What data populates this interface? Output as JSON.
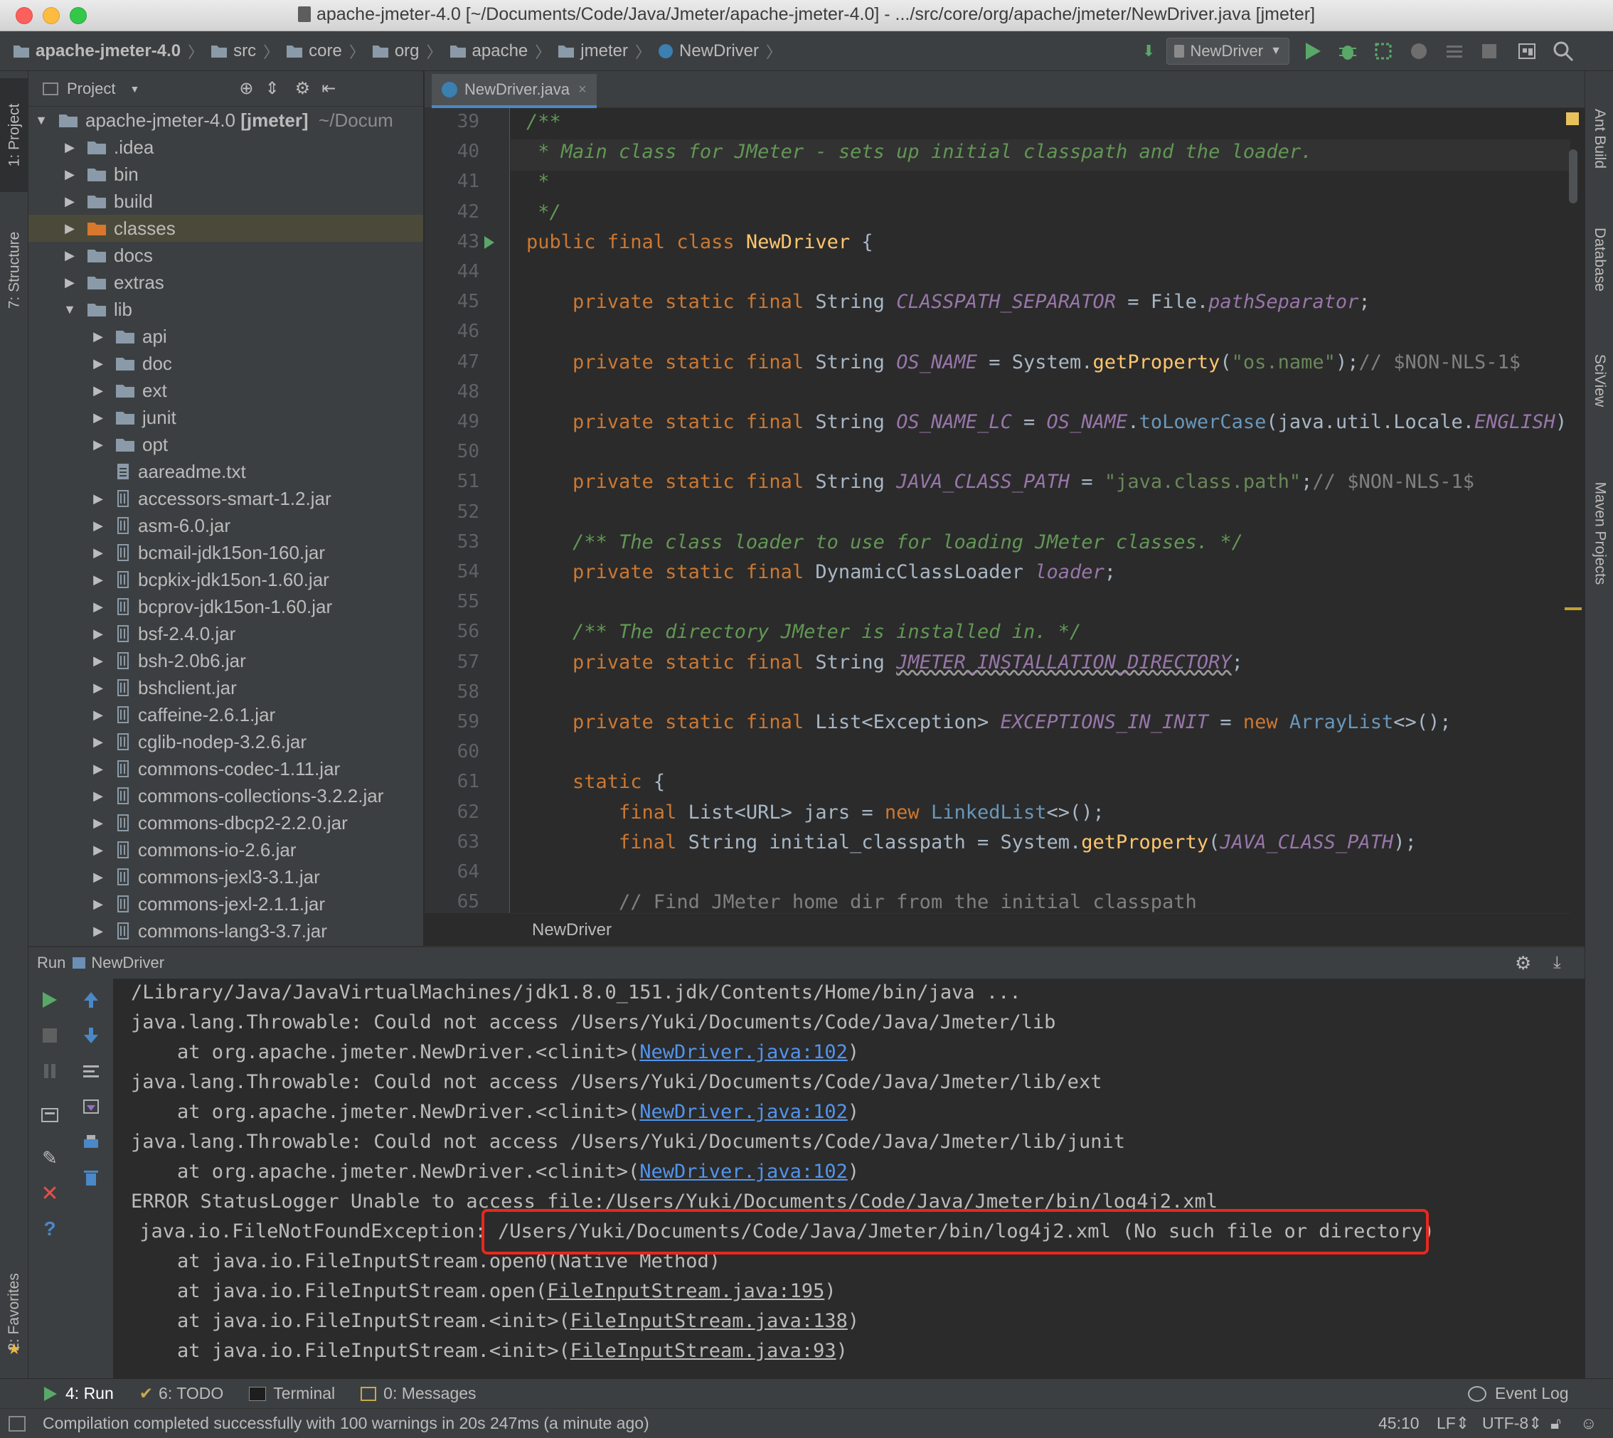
{
  "window": {
    "title": "apache-jmeter-4.0 [~/Documents/Code/Java/Jmeter/apache-jmeter-4.0] - .../src/core/org/apache/jmeter/NewDriver.java [jmeter]"
  },
  "navbar": {
    "crumbs": [
      "apache-jmeter-4.0",
      "src",
      "core",
      "org",
      "apache",
      "jmeter",
      "NewDriver"
    ],
    "run_config": "NewDriver"
  },
  "left_strip": {
    "project_tab": "1: Project",
    "structure_tab": "7: Structure",
    "favorites_tab": "2: Favorites"
  },
  "right_strip": {
    "ant": "Ant Build",
    "database": "Database",
    "sciview": "SciView",
    "maven": "Maven Projects"
  },
  "project_panel": {
    "title": "Project",
    "root_name": "apache-jmeter-4.0",
    "root_module": "[jmeter]",
    "root_path": "~/Docum",
    "items": [
      {
        "label": ".idea",
        "type": "folder",
        "level": 1,
        "arrow": "right"
      },
      {
        "label": "bin",
        "type": "folder",
        "level": 1,
        "arrow": "right"
      },
      {
        "label": "build",
        "type": "folder",
        "level": 1,
        "arrow": "right"
      },
      {
        "label": "classes",
        "type": "folder-orange",
        "level": 1,
        "arrow": "right",
        "selected": true
      },
      {
        "label": "docs",
        "type": "folder",
        "level": 1,
        "arrow": "right"
      },
      {
        "label": "extras",
        "type": "folder",
        "level": 1,
        "arrow": "right"
      },
      {
        "label": "lib",
        "type": "folder",
        "level": 1,
        "arrow": "down"
      },
      {
        "label": "api",
        "type": "folder",
        "level": 2,
        "arrow": "right"
      },
      {
        "label": "doc",
        "type": "folder",
        "level": 2,
        "arrow": "right"
      },
      {
        "label": "ext",
        "type": "folder",
        "level": 2,
        "arrow": "right"
      },
      {
        "label": "junit",
        "type": "folder",
        "level": 2,
        "arrow": "right"
      },
      {
        "label": "opt",
        "type": "folder",
        "level": 2,
        "arrow": "right"
      },
      {
        "label": "aareadme.txt",
        "type": "file",
        "level": 2,
        "arrow": ""
      },
      {
        "label": "accessors-smart-1.2.jar",
        "type": "jar",
        "level": 2,
        "arrow": "right"
      },
      {
        "label": "asm-6.0.jar",
        "type": "jar",
        "level": 2,
        "arrow": "right"
      },
      {
        "label": "bcmail-jdk15on-160.jar",
        "type": "jar",
        "level": 2,
        "arrow": "right"
      },
      {
        "label": "bcpkix-jdk15on-1.60.jar",
        "type": "jar",
        "level": 2,
        "arrow": "right"
      },
      {
        "label": "bcprov-jdk15on-1.60.jar",
        "type": "jar",
        "level": 2,
        "arrow": "right"
      },
      {
        "label": "bsf-2.4.0.jar",
        "type": "jar",
        "level": 2,
        "arrow": "right"
      },
      {
        "label": "bsh-2.0b6.jar",
        "type": "jar",
        "level": 2,
        "arrow": "right"
      },
      {
        "label": "bshclient.jar",
        "type": "jar",
        "level": 2,
        "arrow": "right"
      },
      {
        "label": "caffeine-2.6.1.jar",
        "type": "jar",
        "level": 2,
        "arrow": "right"
      },
      {
        "label": "cglib-nodep-3.2.6.jar",
        "type": "jar",
        "level": 2,
        "arrow": "right"
      },
      {
        "label": "commons-codec-1.11.jar",
        "type": "jar",
        "level": 2,
        "arrow": "right"
      },
      {
        "label": "commons-collections-3.2.2.jar",
        "type": "jar",
        "level": 2,
        "arrow": "right"
      },
      {
        "label": "commons-dbcp2-2.2.0.jar",
        "type": "jar",
        "level": 2,
        "arrow": "right"
      },
      {
        "label": "commons-io-2.6.jar",
        "type": "jar",
        "level": 2,
        "arrow": "right"
      },
      {
        "label": "commons-jexl3-3.1.jar",
        "type": "jar",
        "level": 2,
        "arrow": "right"
      },
      {
        "label": "commons-jexl-2.1.1.jar",
        "type": "jar",
        "level": 2,
        "arrow": "right"
      },
      {
        "label": "commons-lang3-3.7.jar",
        "type": "jar",
        "level": 2,
        "arrow": "right"
      }
    ]
  },
  "editor": {
    "tab_label": "NewDriver.java",
    "line_numbers": [
      "39",
      "40",
      "41",
      "42",
      "43",
      "44",
      "45",
      "46",
      "47",
      "48",
      "49",
      "50",
      "51",
      "52",
      "53",
      "54",
      "55",
      "56",
      "57",
      "58",
      "59",
      "60",
      "61",
      "62",
      "63",
      "64",
      "65"
    ],
    "lines": [
      [
        {
          "c": "ccm",
          "t": "/**"
        }
      ],
      [
        {
          "c": "ccm",
          "t": " * Main class for JMeter - sets up initial classpath and the loader."
        }
      ],
      [
        {
          "c": "ccm",
          "t": " *"
        }
      ],
      [
        {
          "c": "ccm",
          "t": " */"
        }
      ],
      [
        {
          "c": "kw",
          "t": "public final class "
        },
        {
          "c": "ty",
          "t": "NewDriver"
        },
        {
          "c": "",
          "t": " {"
        }
      ],
      [],
      [
        {
          "c": "kw",
          "t": "    private static final "
        },
        {
          "c": "",
          "t": "String "
        },
        {
          "c": "cn",
          "t": "CLASSPATH_SEPARATOR"
        },
        {
          "c": "",
          "t": " = File."
        },
        {
          "c": "sm",
          "t": "pathSeparator"
        },
        {
          "c": "",
          "t": ";"
        }
      ],
      [],
      [
        {
          "c": "kw",
          "t": "    private static final "
        },
        {
          "c": "",
          "t": "String "
        },
        {
          "c": "cn",
          "t": "OS_NAME"
        },
        {
          "c": "",
          "t": " = System."
        },
        {
          "c": "mt",
          "t": "getProperty"
        },
        {
          "c": "",
          "t": "("
        },
        {
          "c": "st",
          "t": "\"os.name\""
        },
        {
          "c": "",
          "t": ");"
        },
        {
          "c": "cm",
          "t": "// $NON-NLS-1$"
        }
      ],
      [],
      [
        {
          "c": "kw",
          "t": "    private static final "
        },
        {
          "c": "",
          "t": "String "
        },
        {
          "c": "cn",
          "t": "OS_NAME_LC"
        },
        {
          "c": "",
          "t": " = "
        },
        {
          "c": "cn",
          "t": "OS_NAME"
        },
        {
          "c": "",
          "t": "."
        },
        {
          "c": "ur",
          "t": "toLowerCase"
        },
        {
          "c": "",
          "t": "(java.util.Locale."
        },
        {
          "c": "sm",
          "t": "ENGLISH"
        },
        {
          "c": "",
          "t": ");"
        }
      ],
      [],
      [
        {
          "c": "kw",
          "t": "    private static final "
        },
        {
          "c": "",
          "t": "String "
        },
        {
          "c": "cn",
          "t": "JAVA_CLASS_PATH"
        },
        {
          "c": "",
          "t": " = "
        },
        {
          "c": "st",
          "t": "\"java.class.path\""
        },
        {
          "c": "",
          "t": ";"
        },
        {
          "c": "cm",
          "t": "// $NON-NLS-1$"
        }
      ],
      [],
      [
        {
          "c": "ccm",
          "t": "    /** The class loader to use for loading JMeter classes. */"
        }
      ],
      [
        {
          "c": "kw",
          "t": "    private static final "
        },
        {
          "c": "",
          "t": "DynamicClassLoader "
        },
        {
          "c": "cn",
          "t": "loader"
        },
        {
          "c": "",
          "t": ";"
        }
      ],
      [],
      [
        {
          "c": "ccm",
          "t": "    /** The directory JMeter is installed in. */"
        }
      ],
      [
        {
          "c": "kw",
          "t": "    private static final "
        },
        {
          "c": "",
          "t": "String "
        },
        {
          "c": "cn",
          "t": "JMETER_INSTALLATION_DIRECTORY"
        },
        {
          "c": "",
          "t": ";"
        }
      ],
      [],
      [
        {
          "c": "kw",
          "t": "    private static final "
        },
        {
          "c": "",
          "t": "List<Exception> "
        },
        {
          "c": "cn",
          "t": "EXCEPTIONS_IN_INIT"
        },
        {
          "c": "",
          "t": " = "
        },
        {
          "c": "kw",
          "t": "new "
        },
        {
          "c": "ur",
          "t": "ArrayList"
        },
        {
          "c": "",
          "t": "<>();"
        }
      ],
      [],
      [
        {
          "c": "kw",
          "t": "    static "
        },
        {
          "c": "",
          "t": "{"
        }
      ],
      [
        {
          "c": "kw",
          "t": "        final "
        },
        {
          "c": "",
          "t": "List<URL> jars = "
        },
        {
          "c": "kw",
          "t": "new "
        },
        {
          "c": "ur",
          "t": "LinkedList"
        },
        {
          "c": "",
          "t": "<>();"
        }
      ],
      [
        {
          "c": "kw",
          "t": "        final "
        },
        {
          "c": "",
          "t": "String initial_classpath = System."
        },
        {
          "c": "mt",
          "t": "getProperty"
        },
        {
          "c": "",
          "t": "("
        },
        {
          "c": "cn",
          "t": "JAVA_CLASS_PATH"
        },
        {
          "c": "",
          "t": ");"
        }
      ],
      [],
      [
        {
          "c": "cm",
          "t": "        // Find JMeter home dir from the initial classpath"
        }
      ]
    ],
    "bottom_breadcrumb": "NewDriver"
  },
  "run_panel": {
    "label": "Run",
    "config": "NewDriver",
    "console": [
      [
        {
          "c": "",
          "t": "/Library/Java/JavaVirtualMachines/jdk1.8.0_151.jdk/Contents/Home/bin/java ..."
        }
      ],
      [
        {
          "c": "err",
          "t": "java.lang.Throwable: Could not access /Users/Yuki/Documents/Code/Java/Jmeter/lib"
        }
      ],
      [
        {
          "c": "err",
          "t": "    at org.apache.jmeter.NewDriver.<clinit>("
        },
        {
          "c": "lk",
          "t": "NewDriver.java:102"
        },
        {
          "c": "err",
          "t": ")"
        }
      ],
      [
        {
          "c": "err",
          "t": "java.lang.Throwable: Could not access /Users/Yuki/Documents/Code/Java/Jmeter/lib/ext"
        }
      ],
      [
        {
          "c": "err",
          "t": "    at org.apache.jmeter.NewDriver.<clinit>("
        },
        {
          "c": "lk",
          "t": "NewDriver.java:102"
        },
        {
          "c": "err",
          "t": ")"
        }
      ],
      [
        {
          "c": "err",
          "t": "java.lang.Throwable: Could not access /Users/Yuki/Documents/Code/Java/Jmeter/lib/junit"
        }
      ],
      [
        {
          "c": "err",
          "t": "    at org.apache.jmeter.NewDriver.<clinit>("
        },
        {
          "c": "lk",
          "t": "NewDriver.java:102"
        },
        {
          "c": "err",
          "t": ")"
        }
      ],
      [
        {
          "c": "err",
          "t": "ERROR StatusLogger Unable to access file:/Users/Yuki/Documents/Code/Java/Jmeter/bin/log4j2.xml"
        }
      ],
      [
        {
          "c": "err",
          "t": " java.io.FileNotFoundException: /Users/Yuki/Documents/Code/Java/Jmeter/bin/log4j2.xml (No such file or directory)"
        }
      ],
      [
        {
          "c": "err",
          "t": "    at java.io.FileInputStream.open0(Native Method)"
        }
      ],
      [
        {
          "c": "err",
          "t": "    at java.io.FileInputStream.open("
        },
        {
          "c": "lkg",
          "t": "FileInputStream.java:195"
        },
        {
          "c": "err",
          "t": ")"
        }
      ],
      [
        {
          "c": "err",
          "t": "    at java.io.FileInputStream.<init>("
        },
        {
          "c": "lkg",
          "t": "FileInputStream.java:138"
        },
        {
          "c": "err",
          "t": ")"
        }
      ],
      [
        {
          "c": "err",
          "t": "    at java.io.FileInputStream.<init>("
        },
        {
          "c": "lkg",
          "t": "FileInputStream.java:93"
        },
        {
          "c": "err",
          "t": ")"
        }
      ]
    ]
  },
  "bottom_tools": {
    "run": "4: Run",
    "todo": "6: TODO",
    "terminal": "Terminal",
    "messages": "0: Messages",
    "event_log": "Event Log"
  },
  "status": {
    "message": "Compilation completed successfully with 100 warnings in 20s 247ms (a minute ago)",
    "position": "45:10",
    "line_sep": "LF",
    "encoding": "UTF-8"
  },
  "colors": {
    "accent": "#4a88c7",
    "error": "#ff6b68",
    "highlight_box": "#e8281d",
    "run_green": "#59a869"
  }
}
